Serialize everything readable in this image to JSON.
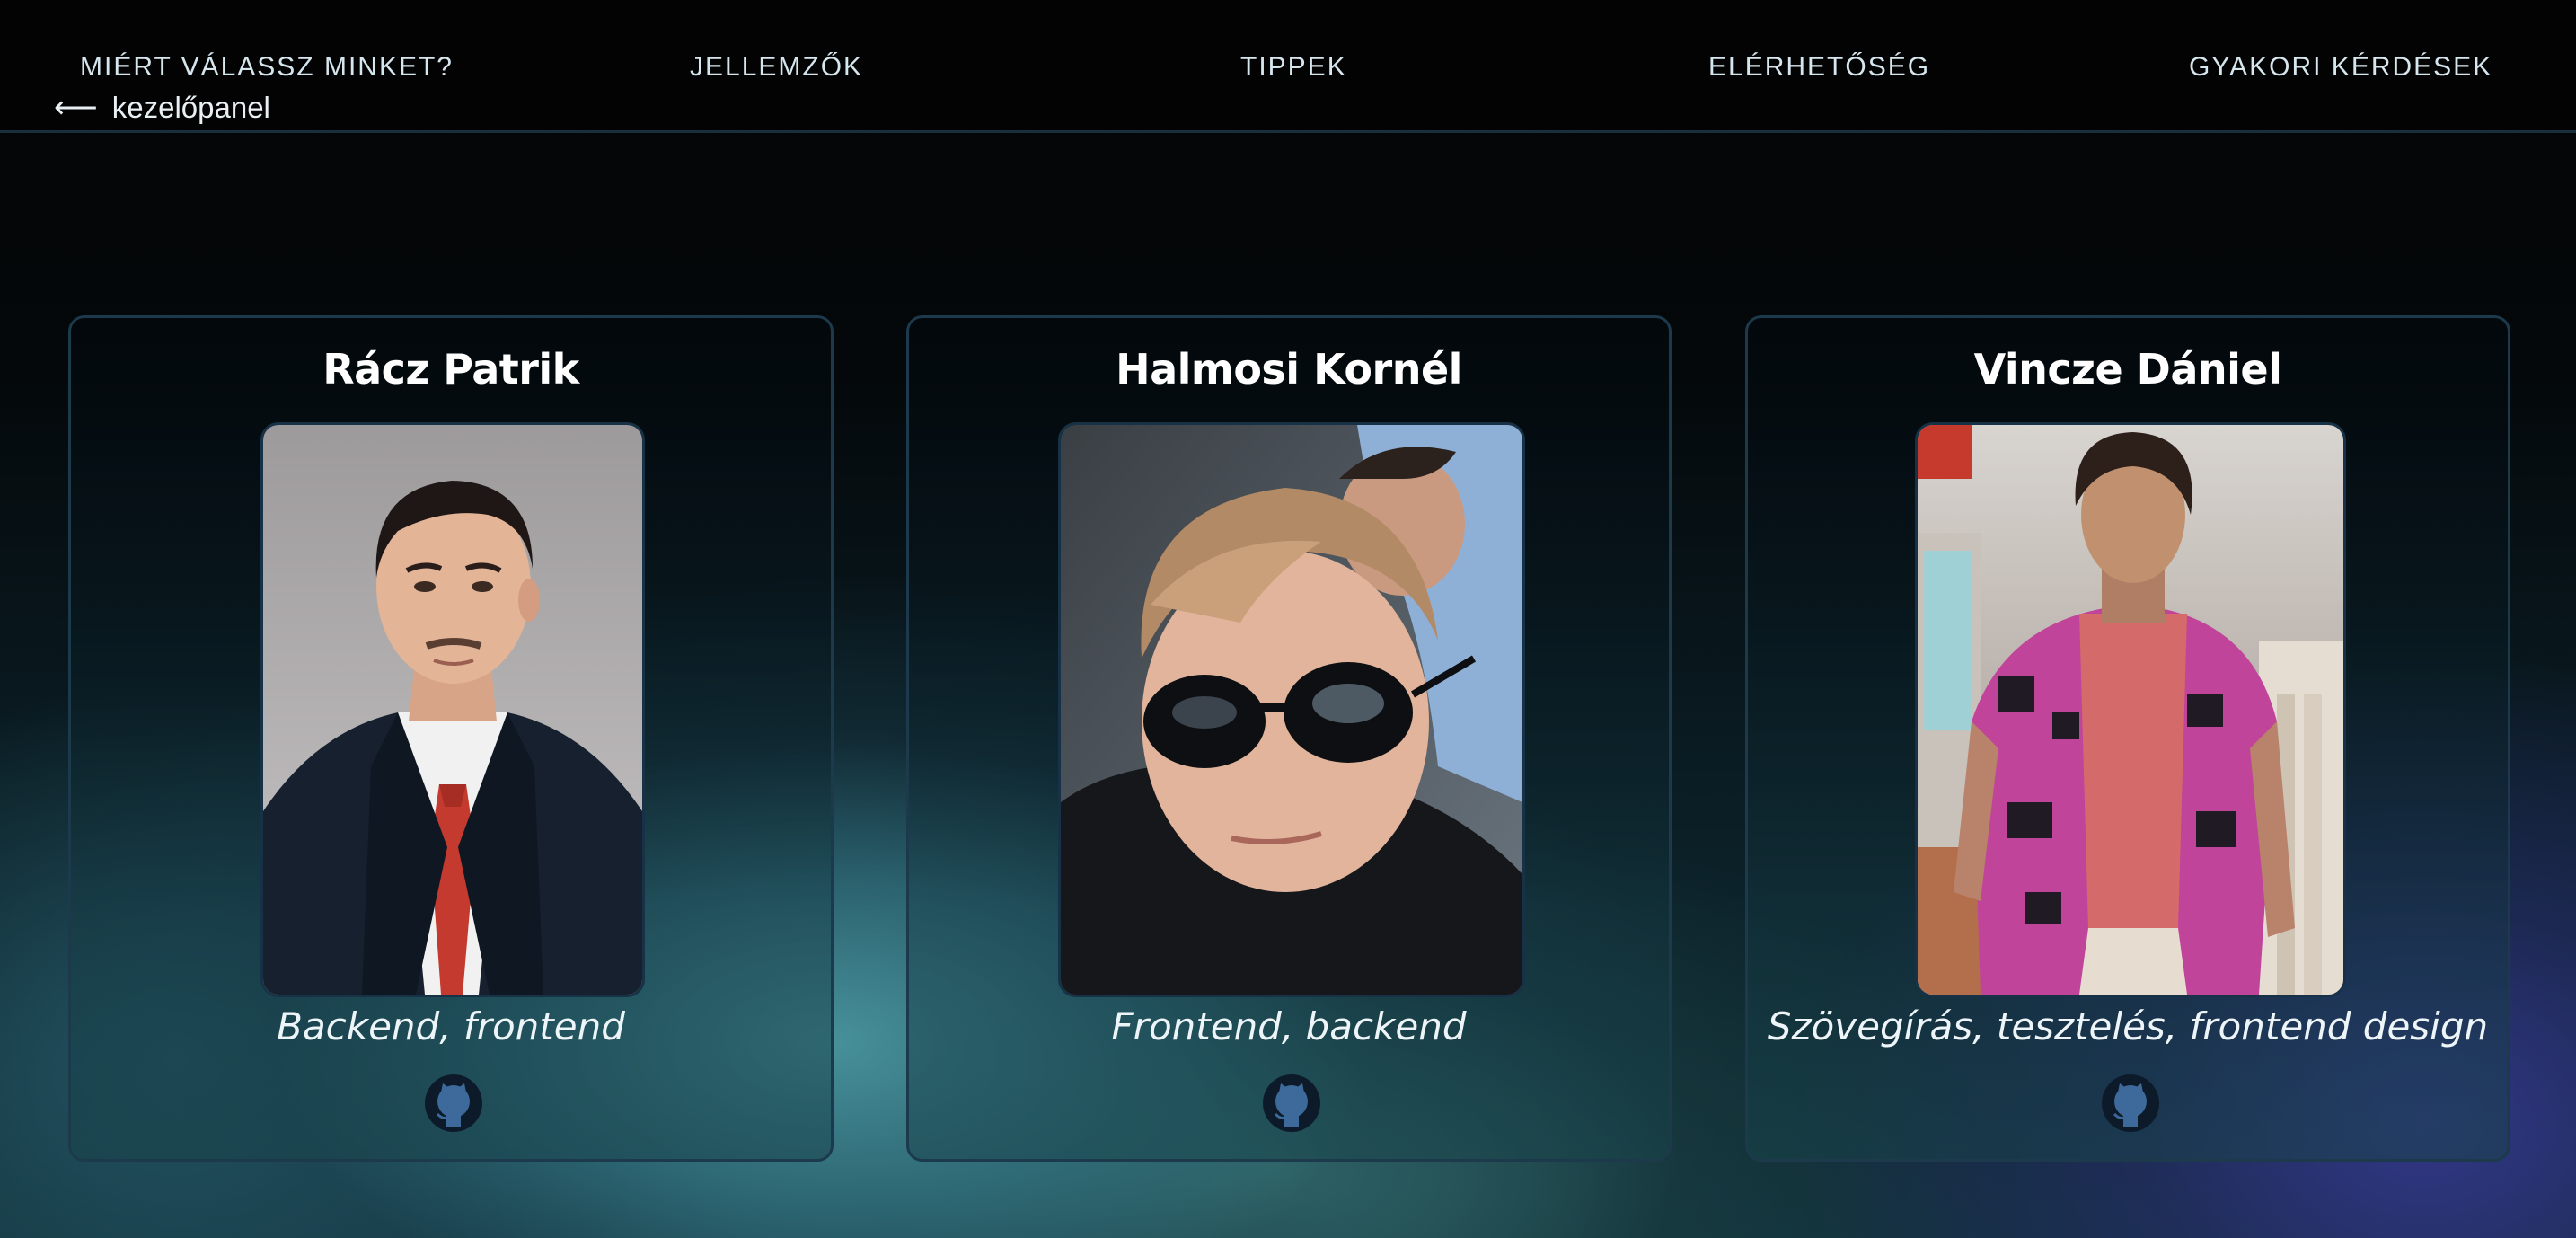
{
  "nav": {
    "items": [
      {
        "label": "MIÉRT VÁLASSZ MINKET?"
      },
      {
        "label": "JELLEMZŐK"
      },
      {
        "label": "TIPPEK"
      },
      {
        "label": "ELÉRHETŐSÉG"
      },
      {
        "label": "GYAKORI KÉRDÉSEK"
      }
    ],
    "back": {
      "arrow": "⟵",
      "label": "kezelőpanel"
    }
  },
  "team": [
    {
      "name": "Rácz Patrik",
      "role": "Backend, frontend",
      "photo": "portrait-photo",
      "link_icon": "github-icon"
    },
    {
      "name": "Halmosi Kornél",
      "role": "Frontend, backend",
      "photo": "selfie-photo",
      "link_icon": "github-icon"
    },
    {
      "name": "Vincze Dániel",
      "role": "Szövegírás, tesztelés, frontend design",
      "photo": "store-photo",
      "link_icon": "github-icon"
    }
  ],
  "colors": {
    "header_bg": "#030303",
    "card_border": "#1c3a4c",
    "github_icon_bg": "#0d1a2a",
    "github_icon_fg": "#3d6a9a",
    "accent_teal": "#4a96a0",
    "accent_indigo": "#34388c"
  }
}
